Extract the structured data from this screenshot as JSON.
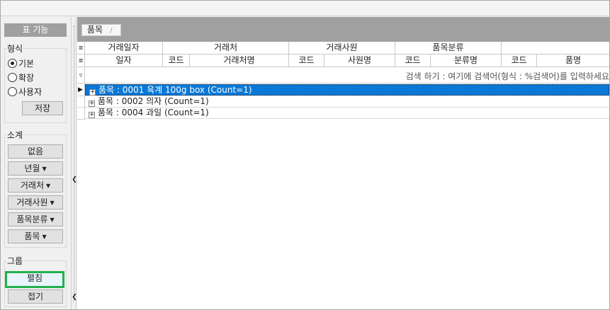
{
  "left_panel": {
    "header": "표 기능",
    "format": {
      "title": "형식",
      "options": [
        "기본",
        "확장",
        "사용자"
      ],
      "selected_index": 0,
      "save_label": "저장"
    },
    "subtotal": {
      "title": "소계",
      "buttons": [
        "없음",
        "년월",
        "거래처",
        "거래사원",
        "품목분류",
        "품목"
      ]
    },
    "group": {
      "title": "그룹",
      "expand_label": "펼침",
      "collapse_label": "접기"
    }
  },
  "tab": {
    "label": "품목"
  },
  "grid": {
    "header_top": [
      "거래일자",
      "거래처",
      "거래사원",
      "품목분류",
      ""
    ],
    "header_bottom": [
      "일자",
      "코드",
      "거래처명",
      "코드",
      "사원명",
      "코드",
      "분류명",
      "코드",
      "품명"
    ],
    "filter_placeholder": "검색 하기 : 여기에 검색어(형식 : %검색어)를 입력하세요",
    "group_rows": [
      "품목 : 0001 육계 100g box (Count=1)",
      "품목 : 0002 의자   (Count=1)",
      "품목 : 0004 과일   (Count=1)"
    ],
    "active_row_index": 0
  },
  "colors": {
    "accent_selected": "#0a78d7",
    "highlight_border": "#22b14c",
    "panel_header": "#a0a0a0"
  }
}
